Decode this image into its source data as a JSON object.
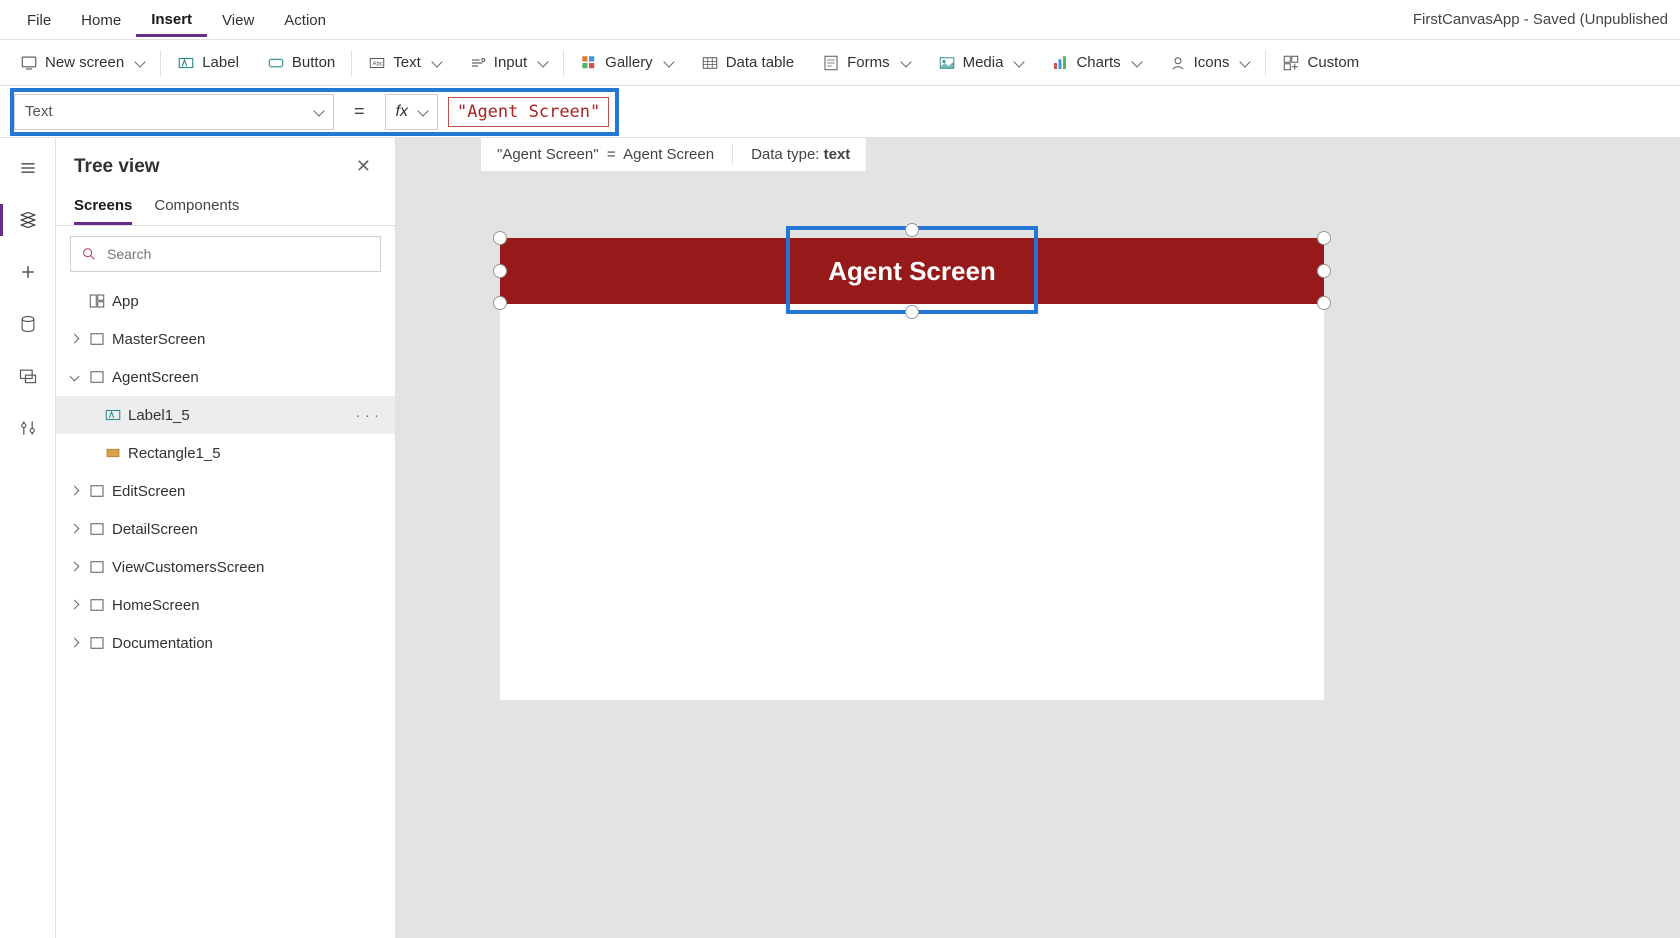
{
  "app_title": "FirstCanvasApp - Saved (Unpublished",
  "menu": {
    "file": "File",
    "home": "Home",
    "insert": "Insert",
    "view": "View",
    "action": "Action"
  },
  "ribbon": {
    "new_screen": "New screen",
    "label": "Label",
    "button": "Button",
    "text": "Text",
    "input": "Input",
    "gallery": "Gallery",
    "data_table": "Data table",
    "forms": "Forms",
    "media": "Media",
    "charts": "Charts",
    "icons": "Icons",
    "custom": "Custom"
  },
  "formula": {
    "property": "Text",
    "fx": "fx",
    "value": "\"Agent Screen\"",
    "equals": "="
  },
  "result": {
    "lhs": "\"Agent Screen\"",
    "eq": "=",
    "rhs": "Agent Screen",
    "datatype_label": "Data type:",
    "datatype_value": "text"
  },
  "tree": {
    "title": "Tree view",
    "tabs": {
      "screens": "Screens",
      "components": "Components"
    },
    "search_placeholder": "Search",
    "app_node": "App",
    "nodes": {
      "master": "MasterScreen",
      "agent": "AgentScreen",
      "label1_5": "Label1_5",
      "rect1_5": "Rectangle1_5",
      "edit": "EditScreen",
      "detail": "DetailScreen",
      "viewcust": "ViewCustomersScreen",
      "home": "HomeScreen",
      "doc": "Documentation"
    },
    "more": "· · ·"
  },
  "canvas": {
    "label_text": "Agent Screen"
  }
}
